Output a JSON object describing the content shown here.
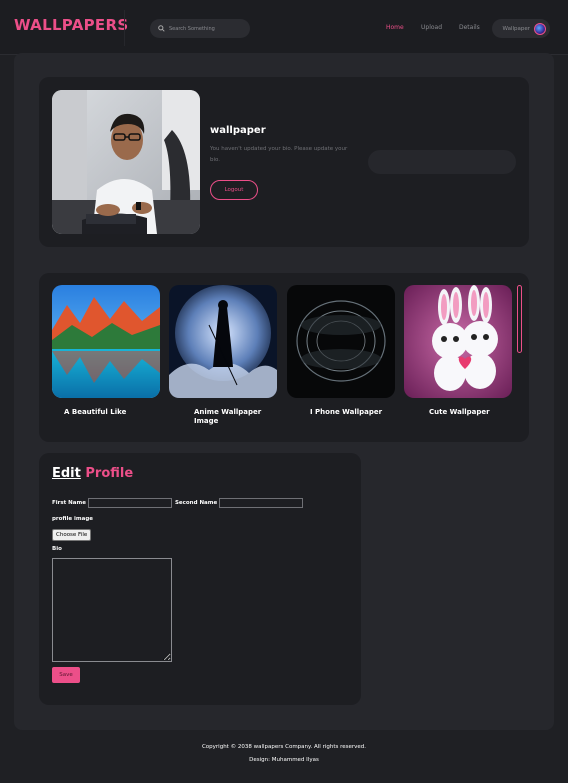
{
  "navbar": {
    "brand": "WALLPAPERS",
    "search_placeholder": "Search Something",
    "links": [
      {
        "label": "Home",
        "active": true
      },
      {
        "label": "Upload",
        "active": false
      },
      {
        "label": "Details",
        "active": false
      }
    ],
    "user_label": "Wallpaper"
  },
  "profile": {
    "name": "wallpaper",
    "bio": "You haven't updated your bio. Please update your bio.",
    "logout_label": "Logout"
  },
  "gallery": {
    "items": [
      {
        "title": "A Beautiful Like"
      },
      {
        "title": "Anime Wallpaper Image"
      },
      {
        "title": "I Phone Wallpaper"
      },
      {
        "title": "Cute Wallpaper"
      }
    ]
  },
  "edit_profile": {
    "title_word1": "Edit",
    "title_word2": "Profile",
    "first_name_label": "First Name",
    "second_name_label": "Second Name",
    "first_name_value": "",
    "second_name_value": "",
    "profile_image_label": "profile image",
    "choose_file_label": "Choose File",
    "bio_label": "Bio",
    "bio_value": "",
    "save_label": "Save"
  },
  "footer": {
    "copyright": "Copyright © 2038 wallpapers Company. All rights reserved.",
    "design": "Design: Muhammed Ilyas"
  },
  "colors": {
    "accent": "#ec4f89",
    "background": "#1f2024",
    "panel": "#26272c",
    "card": "#1d1e22"
  }
}
